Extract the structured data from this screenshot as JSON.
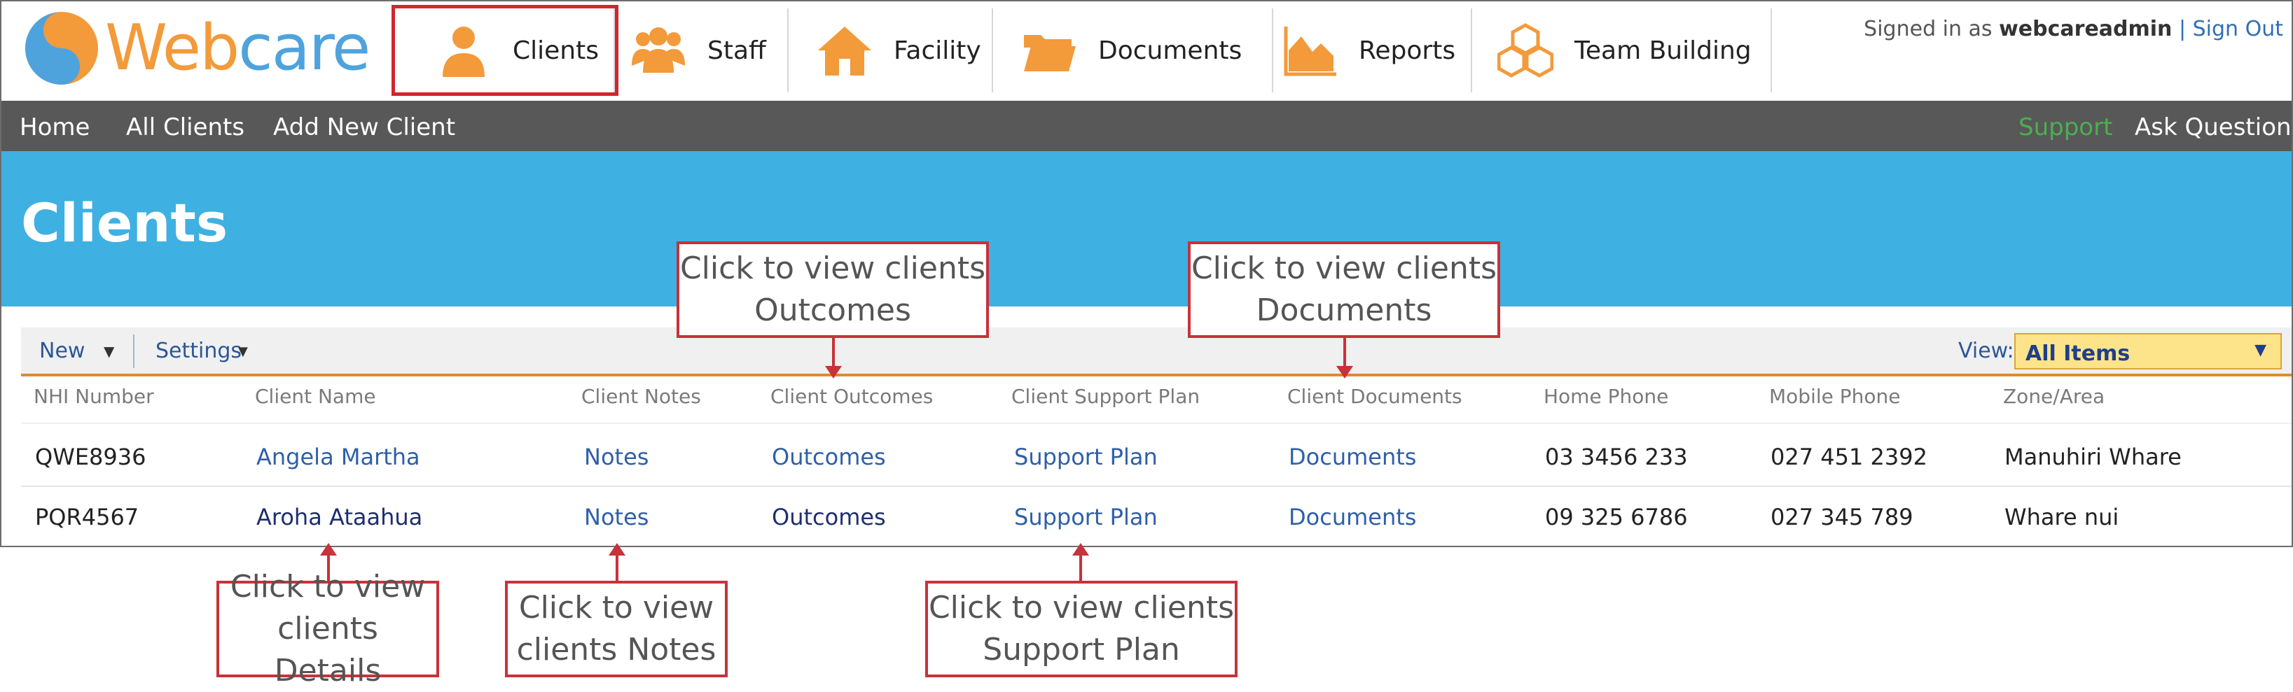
{
  "logo": {
    "part1": "Web",
    "part2": "care"
  },
  "tabs": [
    {
      "label": "Clients",
      "icon": "person-icon",
      "active": true
    },
    {
      "label": "Staff",
      "icon": "group-icon",
      "active": false
    },
    {
      "label": "Facility",
      "icon": "house-icon",
      "active": false
    },
    {
      "label": "Documents",
      "icon": "folder-icon",
      "active": false
    },
    {
      "label": "Reports",
      "icon": "area-chart-icon",
      "active": false
    },
    {
      "label": "Team Building",
      "icon": "boxes-icon",
      "active": false
    }
  ],
  "user": {
    "prefix": "Signed in as",
    "name": "webcareadmin",
    "sep": "|",
    "signout": "Sign Out"
  },
  "subnav": {
    "home": "Home",
    "all_clients": "All Clients",
    "add_client": "Add New Client",
    "support": "Support",
    "ask": "Ask Question"
  },
  "page_title": "Clients",
  "toolbar": {
    "new": "New",
    "settings": "Settings",
    "view_label": "View:",
    "view_value": "All Items"
  },
  "columns": [
    "NHI Number",
    "Client Name",
    "Client Notes",
    "Client Outcomes",
    "Client Support Plan",
    "Client Documents",
    "Home Phone",
    "Mobile Phone",
    "Zone/Area"
  ],
  "rows": [
    {
      "nhi": "QWE8936",
      "name": "Angela Martha",
      "notes": "Notes",
      "outcomes": "Outcomes",
      "support": "Support Plan",
      "docs": "Documents",
      "home": "03 3456 233",
      "mobile": "027 451 2392",
      "zone": "Manuhiri Whare"
    },
    {
      "nhi": "PQR4567",
      "name": "Aroha Ataahua",
      "notes": "Notes",
      "outcomes": "Outcomes",
      "support": "Support Plan",
      "docs": "Documents",
      "home": "09 325 6786",
      "mobile": "027 345 789",
      "zone": "Whare nui"
    }
  ],
  "callouts": {
    "outcomes": {
      "l1": "Click to view clients",
      "l2": "Outcomes"
    },
    "documents": {
      "l1": "Click to view clients",
      "l2": "Documents"
    },
    "details": {
      "l1": "Click to view",
      "l2": "clients Details"
    },
    "notes": {
      "l1": "Click to view",
      "l2": "clients Notes"
    },
    "support": {
      "l1": "Click to view clients",
      "l2": "Support Plan"
    }
  },
  "colors": {
    "accent_orange": "#f39a3b",
    "banner_blue": "#3fb0e2",
    "callout_red": "#c8323a",
    "subnav_gray": "#585858"
  }
}
